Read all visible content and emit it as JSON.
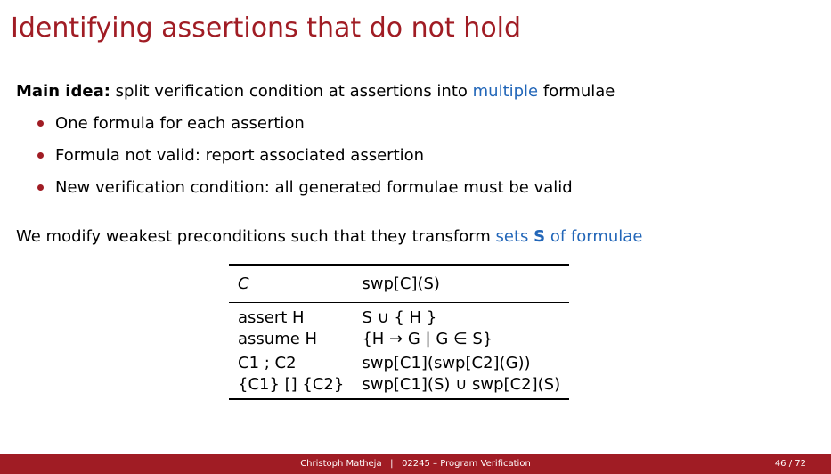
{
  "title": "Identifying assertions that do not hold",
  "main_idea": {
    "label": "Main idea:",
    "text_before": " split verification condition at assertions into ",
    "highlight": "multiple",
    "text_after": " formulae"
  },
  "bullets": [
    "One formula for each assertion",
    "Formula not valid: report associated assertion",
    "New verification condition: all generated formulae must be valid"
  ],
  "modify": {
    "text_before": "We modify weakest preconditions such that they transform ",
    "sets": "sets",
    "S": "S",
    "of_formulae": " of formulae"
  },
  "table": {
    "header": {
      "c": "C",
      "swp": "swp[C](S)"
    },
    "rows": [
      {
        "c": "assert H",
        "result": "S ∪ { H }"
      },
      {
        "c": "assume H",
        "result": "{H → G | G ∈ S}"
      },
      {
        "c": "C1 ; C2",
        "result": "swp[C1](swp[C2](G))"
      },
      {
        "c": "{C1} [] {C2}",
        "result": "swp[C1](S) ∪ swp[C2](S)"
      }
    ]
  },
  "footer": {
    "author": "Christoph Matheja",
    "separator": "|",
    "course": "02245 – Program Verification",
    "page": "46 / 72"
  },
  "colors": {
    "title": "#a01c24",
    "accent_blue": "#2266b8",
    "orange": "#f0a400",
    "footer_bg": "#a01c24"
  }
}
